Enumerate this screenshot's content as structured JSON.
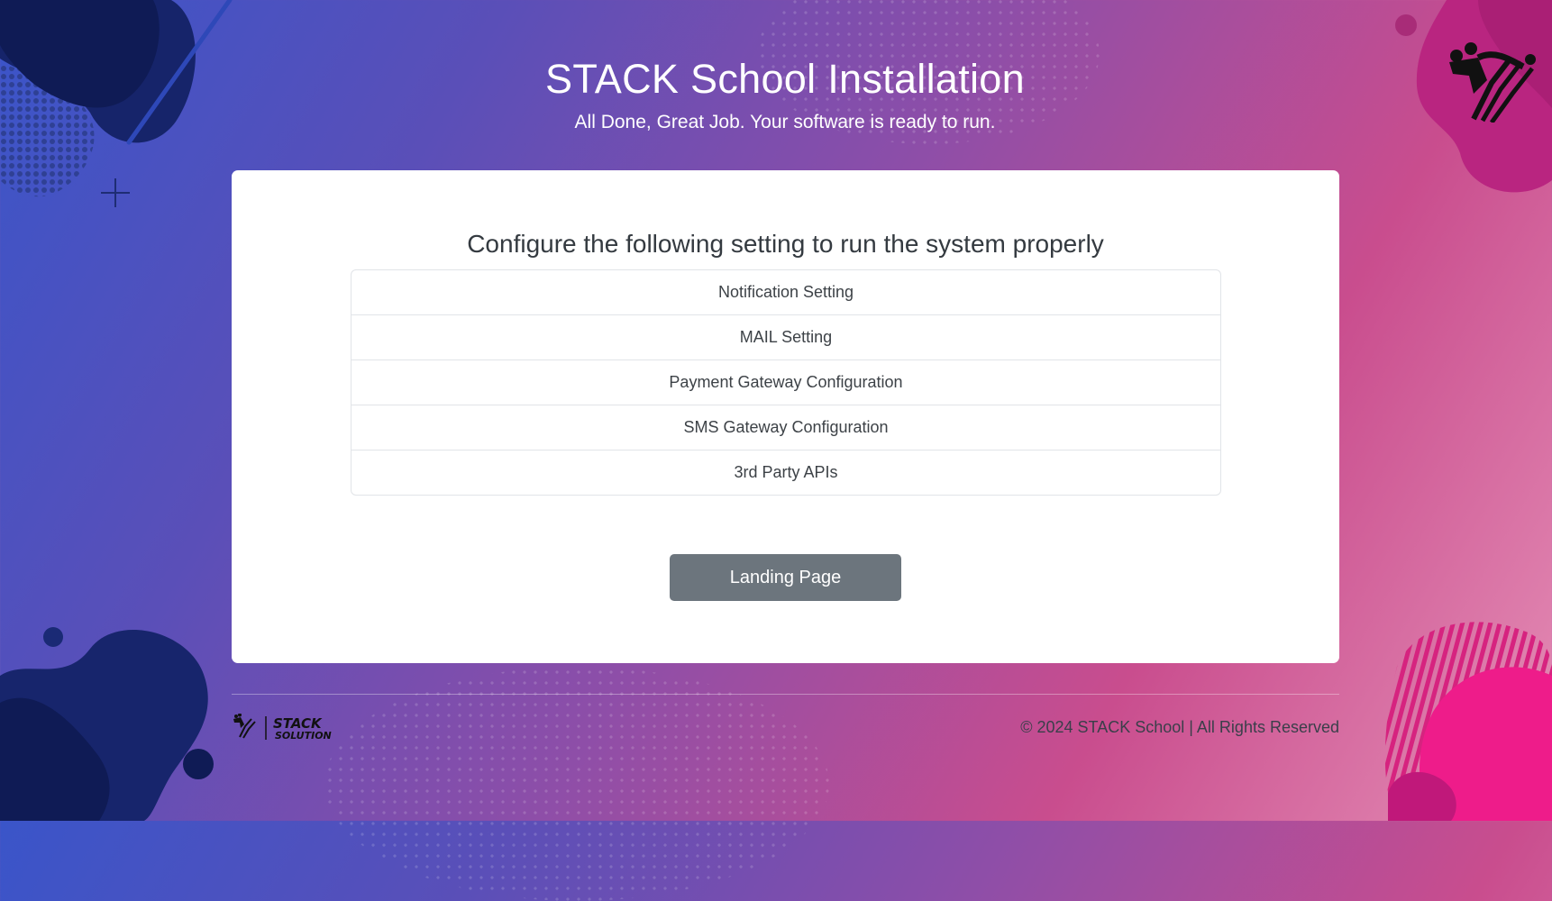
{
  "header": {
    "title": "STACK School Installation",
    "subtitle": "All Done, Great Job. Your software is ready to run."
  },
  "card": {
    "heading": "Configure the following setting to run the system properly",
    "settings": [
      {
        "label": "Notification Setting"
      },
      {
        "label": "MAIL Setting"
      },
      {
        "label": "Payment Gateway Configuration"
      },
      {
        "label": "SMS Gateway Configuration"
      },
      {
        "label": "3rd Party APIs"
      }
    ],
    "button_label": "Landing Page"
  },
  "footer": {
    "logo_text_top": "STACK",
    "logo_text_bottom": "SOLUTION",
    "copyright": "© 2024 STACK School | All Rights Reserved"
  },
  "colors": {
    "button": "#6c757d",
    "card_bg": "#ffffff",
    "gradient_start": "#3a55c9",
    "gradient_end": "#e58fb6"
  },
  "icons": [
    "stack-brand-logo-icon",
    "stack-solution-logo-icon"
  ]
}
